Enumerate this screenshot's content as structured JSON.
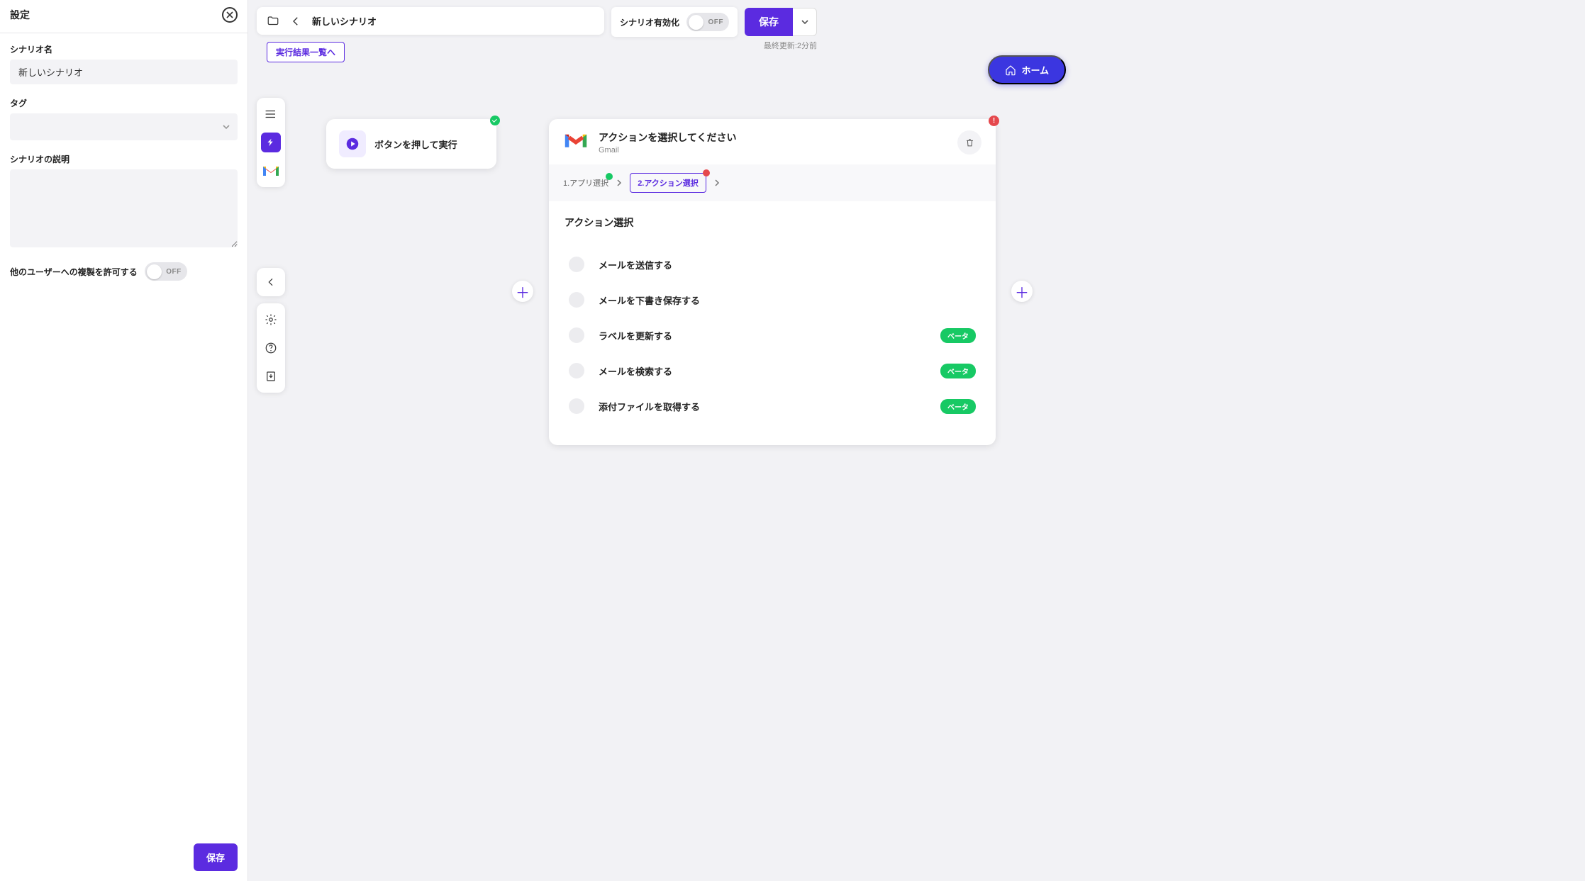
{
  "settings": {
    "panel_title": "設定",
    "name_label": "シナリオ名",
    "name_value": "新しいシナリオ",
    "tag_label": "タグ",
    "desc_label": "シナリオの説明",
    "allow_copy_label": "他のユーザーへの複製を許可する",
    "allow_copy_toggle": "OFF",
    "save_button": "保存"
  },
  "topbar": {
    "scenario_title": "新しいシナリオ",
    "results_button": "実行結果一覧へ",
    "enable_label": "シナリオ有効化",
    "enable_toggle": "OFF",
    "save_button": "保存",
    "last_updated": "最終更新:2分前",
    "home_button": "ホーム"
  },
  "trigger": {
    "label": "ボタンを押して実行"
  },
  "action_card": {
    "title": "アクションを選択してください",
    "app_name": "Gmail",
    "step1": "1.アプリ選択",
    "step2": "2.アクション選択",
    "section_title": "アクション選択",
    "beta_label": "ベータ",
    "options": [
      {
        "label": "メールを送信する",
        "beta": false
      },
      {
        "label": "メールを下書き保存する",
        "beta": false
      },
      {
        "label": "ラベルを更新する",
        "beta": true
      },
      {
        "label": "メールを検索する",
        "beta": true
      },
      {
        "label": "添付ファイルを取得する",
        "beta": true
      }
    ]
  }
}
